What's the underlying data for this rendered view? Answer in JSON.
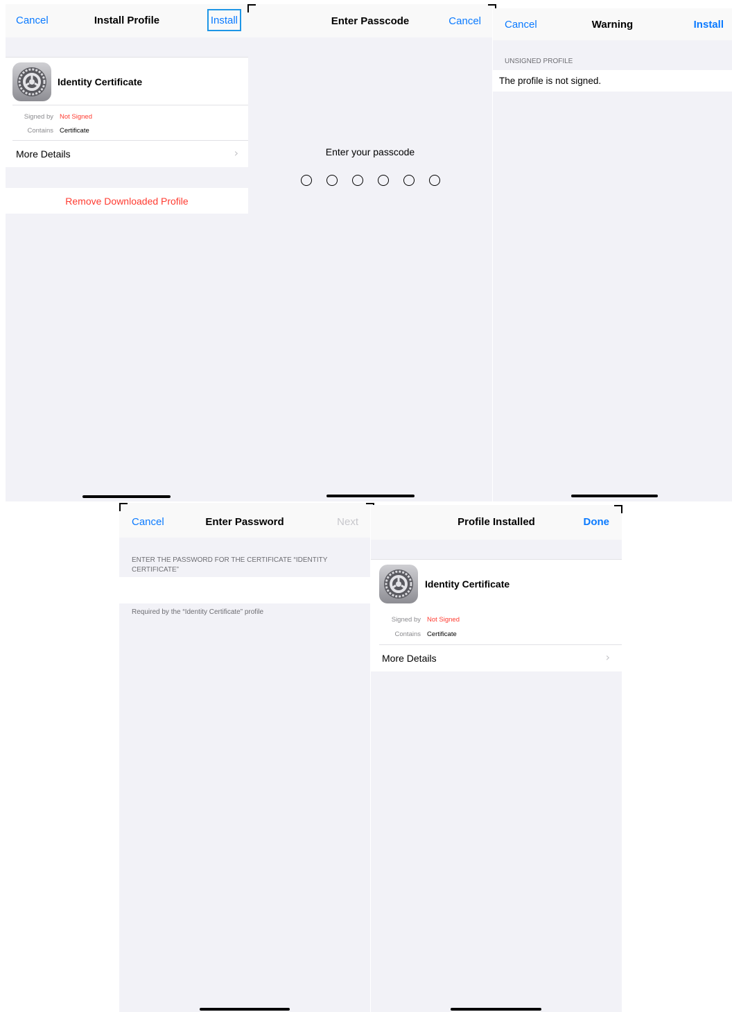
{
  "install_profile": {
    "nav": {
      "cancel": "Cancel",
      "title": "Install Profile",
      "install": "Install"
    },
    "profile_name": "Identity Certificate",
    "signed_by_label": "Signed by",
    "signed_by_value": "Not Signed",
    "contains_label": "Contains",
    "contains_value": "Certificate",
    "more_details": "More Details",
    "remove_button": "Remove Downloaded Profile"
  },
  "enter_passcode": {
    "nav": {
      "title": "Enter Passcode",
      "cancel": "Cancel"
    },
    "prompt": "Enter your passcode",
    "digits": 6
  },
  "warning": {
    "nav": {
      "cancel": "Cancel",
      "title": "Warning",
      "install": "Install"
    },
    "section_header": "UNSIGNED PROFILE",
    "message": "The profile is not signed."
  },
  "enter_password": {
    "nav": {
      "cancel": "Cancel",
      "title": "Enter Password",
      "next": "Next"
    },
    "section_header": "ENTER THE PASSWORD FOR THE CERTIFICATE “IDENTITY CERTIFICATE”",
    "password_value": "",
    "footer": "Required by the “Identity Certificate” profile"
  },
  "profile_installed": {
    "nav": {
      "title": "Profile Installed",
      "done": "Done"
    },
    "profile_name": "Identity Certificate",
    "signed_by_label": "Signed by",
    "signed_by_value": "Not Signed",
    "contains_label": "Contains",
    "contains_value": "Certificate",
    "more_details": "More Details"
  },
  "icons": {
    "settings": "settings-gear-icon",
    "chevron": "chevron-right-icon"
  },
  "colors": {
    "link": "#0a7aff",
    "destructive": "#ff3b30",
    "grouped_background": "#f2f2f7",
    "highlight_box": "#1e96e6"
  }
}
